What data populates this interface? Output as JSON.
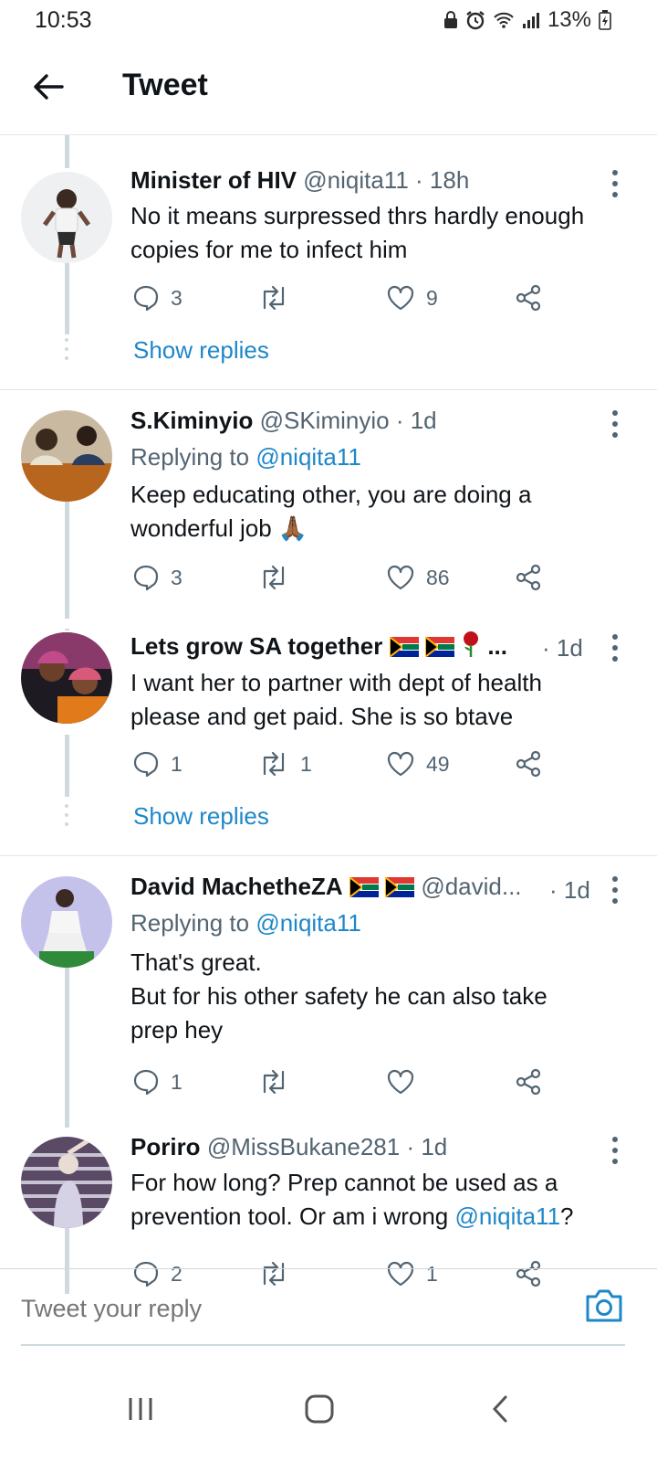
{
  "status_bar": {
    "time": "10:53",
    "battery": "13%"
  },
  "header": {
    "title": "Tweet"
  },
  "tweets": [
    {
      "name": "Minister of HIV",
      "handle": "@niqita11",
      "time": "· 18h",
      "replying_to": "",
      "text_lines": [
        "No it means surpressed thrs hardly enough",
        "copies for me to infect him"
      ],
      "replies": "3",
      "retweets": "",
      "likes": "9",
      "show_replies": "Show replies"
    },
    {
      "name": "S.Kiminyio",
      "handle": "@SKiminyio",
      "time": "· 1d",
      "replying_to_prefix": "Replying to",
      "replying_to": "@niqita11",
      "text_lines": [
        "Keep educating other, you are doing a",
        "wonderful job"
      ],
      "emoji": "🙏🏾",
      "replies": "3",
      "retweets": "",
      "likes": "86"
    },
    {
      "name": "Lets grow SA together",
      "handle": "",
      "name_suffix": "...",
      "time": "· 1d",
      "text_lines": [
        "I want her to partner with dept of health",
        "please and get paid. She is so btave"
      ],
      "replies": "1",
      "retweets": "1",
      "likes": "49",
      "show_replies": "Show replies"
    },
    {
      "name": "David MachetheZA",
      "handle": "@david...",
      "time": "· 1d",
      "replying_to_prefix": "Replying to",
      "replying_to": "@niqita11",
      "text_lines": [
        "That's great.",
        "But for his other safety he can also take",
        "prep hey"
      ],
      "replies": "1",
      "retweets": "",
      "likes": ""
    },
    {
      "name": "Poriro",
      "handle": "@MissBukane281",
      "time": "· 1d",
      "text_lines": [
        "For how long? Prep cannot be used as a",
        "prevention tool. Or am i wrong "
      ],
      "text_mention": "@niqita11",
      "text_end": "?",
      "replies": "2",
      "retweets": "",
      "likes": "1"
    }
  ],
  "reply_bar": {
    "placeholder": "Tweet your reply"
  },
  "colors": {
    "link": "#1e87c9",
    "secondary_text": "#536471",
    "thread_line": "#cfd9de"
  },
  "icons": [
    "back-arrow-icon",
    "reply-icon",
    "retweet-icon",
    "like-icon",
    "share-icon",
    "camera-icon",
    "more-icon"
  ]
}
